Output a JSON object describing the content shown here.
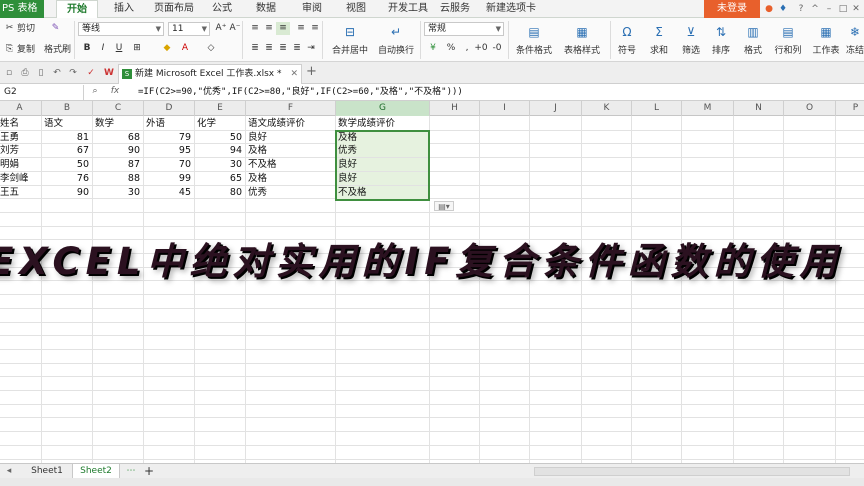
{
  "app": {
    "logo": "PS 表格",
    "login": "未登录"
  },
  "menu": {
    "tabs": [
      "开始",
      "插入",
      "页面布局",
      "公式",
      "数据",
      "审阅",
      "视图",
      "开发工具",
      "云服务",
      "新建选项卡"
    ]
  },
  "ribbon": {
    "cut": "剪切",
    "copy": "复制",
    "format_painter": "格式刷",
    "font_name": "等线",
    "font_size": "11",
    "number_format": "常规",
    "merge_center": "合并居中",
    "wrap_text": "自动换行",
    "cond_format": "条件格式",
    "table_style": "表格样式",
    "symbol": "符号",
    "sum": "求和",
    "filter": "筛选",
    "sort": "排序",
    "format": "格式",
    "row_col": "行和列",
    "worksheet": "工作表",
    "freeze": "冻结"
  },
  "document": {
    "tab_title": "新建 Microsoft Excel 工作表.xlsx *"
  },
  "formula_bar": {
    "cell_ref": "G2",
    "fx": "fx",
    "formula": "=IF(C2>=90,\"优秀\",IF(C2>=80,\"良好\",IF(C2>=60,\"及格\",\"不及格\")))"
  },
  "columns": [
    "A",
    "B",
    "C",
    "D",
    "E",
    "F",
    "G",
    "H",
    "I",
    "J",
    "K",
    "L",
    "M",
    "N",
    "O",
    "P"
  ],
  "table": {
    "headers": [
      "姓名",
      "语文",
      "数学",
      "外语",
      "化学",
      "语文成绩评价",
      "数学成绩评价"
    ],
    "rows": [
      [
        "王勇",
        "81",
        "68",
        "79",
        "50",
        "良好",
        "及格"
      ],
      [
        "刘芳",
        "67",
        "90",
        "95",
        "94",
        "及格",
        "优秀"
      ],
      [
        "明娟",
        "50",
        "87",
        "70",
        "30",
        "不及格",
        "良好"
      ],
      [
        "李剑峰",
        "76",
        "88",
        "99",
        "65",
        "及格",
        "良好"
      ],
      [
        "王五",
        "90",
        "30",
        "45",
        "80",
        "优秀",
        "不及格"
      ]
    ]
  },
  "overlay": {
    "title": "EXCEL中绝对实用的IF复合条件函数的使用"
  },
  "sheets": [
    "Sheet1",
    "Sheet2"
  ],
  "active_sheet": "Sheet2",
  "colors": {
    "accent": "#2f8f3a",
    "login": "#e8602c",
    "selection": "#3f8f3f"
  }
}
